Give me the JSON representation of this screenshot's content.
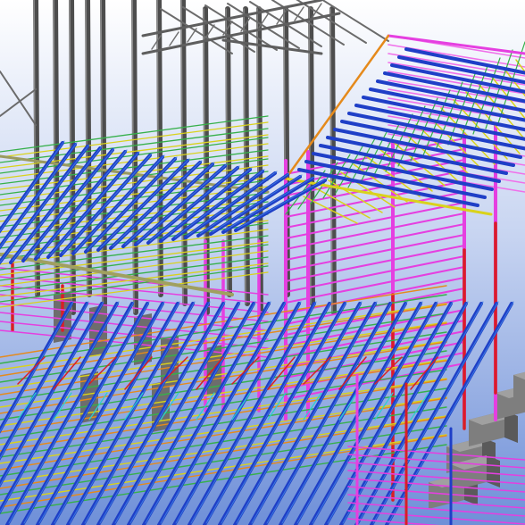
{
  "viewport": {
    "description_visible_text": "",
    "colors": {
      "sky_top": "#ffffff",
      "sky_bottom": "#6e8fd6",
      "ground": "#8aa6e6",
      "concrete": "#7e7e7e",
      "concrete_dark": "#5a5a5a",
      "steel_column": "#4d4d4d",
      "wall_girt": "#e53fe0",
      "wall_girt_light": "#f070ea",
      "purlin_blue": "#1f3fc7",
      "purlin_blue_light": "#3a78e0",
      "bracing_yellow": "#d9d21c",
      "bracing_green": "#36b04a",
      "bracing_orange": "#e58a1c",
      "bracing_red": "#d81f26",
      "cyan": "#2ad0d0"
    }
  }
}
